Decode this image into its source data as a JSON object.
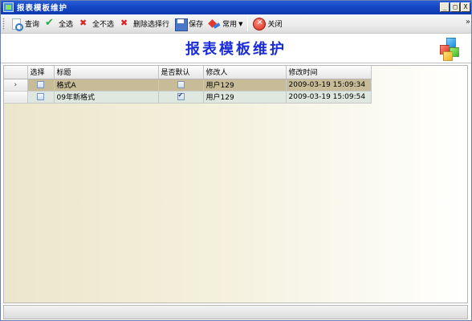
{
  "window": {
    "title": "报表模板维护",
    "controls": [
      "_",
      "□",
      "X"
    ]
  },
  "toolbar": {
    "items": [
      {
        "label": "查询",
        "icon": "search-icon"
      },
      {
        "label": "全选",
        "icon": "check-icon"
      },
      {
        "label": "全不选",
        "icon": "x-icon"
      },
      {
        "label": "删除选择行",
        "icon": "delete-icon"
      },
      {
        "label": "保存",
        "icon": "save-icon"
      },
      {
        "label": "常用",
        "icon": "common-icon",
        "dropdown": true
      },
      {
        "label": "关闭",
        "icon": "close-icon"
      }
    ],
    "overflow": "»"
  },
  "banner": {
    "heading": "报表模板维护",
    "colors": {
      "heading": "#1a2dd6"
    }
  },
  "grid": {
    "columns": [
      "选择",
      "标题",
      "是否默认",
      "修改人",
      "修改时间"
    ],
    "current_row_indicator": "›",
    "rows": [
      {
        "selected": false,
        "title": "格式A",
        "is_default": false,
        "modifier": "用户129",
        "modified_time": "2009-03-19 15:09:34",
        "current": true
      },
      {
        "selected": false,
        "title": "09年新格式",
        "is_default": true,
        "modifier": "用户129",
        "modified_time": "2009-03-19 15:09:54",
        "current": false
      }
    ]
  },
  "colors": {
    "titlebar": "#1446c4",
    "current_row": "#c8bc98",
    "alt_row": "#dfe8e0"
  }
}
